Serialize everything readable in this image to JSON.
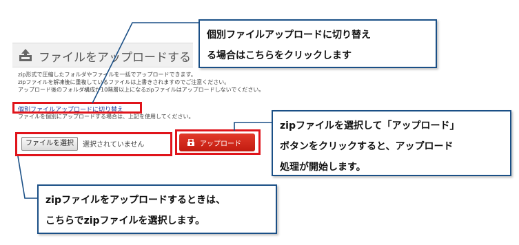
{
  "panel": {
    "title": "ファイルをアップロードする",
    "icon": "upload-icon",
    "description_lines": [
      "zip形式で圧縮したフォルダやファイルを一括でアップロードできます。",
      "zipファイルを解凍後に重複しているファイルは上書きされますのでご注意ください。",
      "アップロード後のフォルダ構成が10階層以上になるzipファイルはアップロードしないでください。"
    ],
    "switch_link": "個別ファイルアップロードに切り替え",
    "switch_note": "ファイルを個別にアップロードする場合は、上記を使用してください。"
  },
  "file_picker": {
    "button_label": "ファイルを選択",
    "status": "選択されていません"
  },
  "upload_button": {
    "label": "アップロード",
    "icon": "lock-icon"
  },
  "callouts": {
    "individual": {
      "line1": "個別ファイルアップロードに切り替え",
      "line2": "る場合はこちらをクリックします"
    },
    "upload": {
      "line1": "zipファイルを選択して「アップロード」",
      "line2": "ボタンをクリックすると、アップロード",
      "line3": "処理が開始します。"
    },
    "select": {
      "line1": "zipファイルをアップロードするときは、",
      "line2": "こちらでzipファイルを選択します。"
    }
  },
  "colors": {
    "highlight": "#e0141b",
    "callout_border": "#1a4f86",
    "link": "#1a3c9c",
    "button": "#c21b10"
  }
}
